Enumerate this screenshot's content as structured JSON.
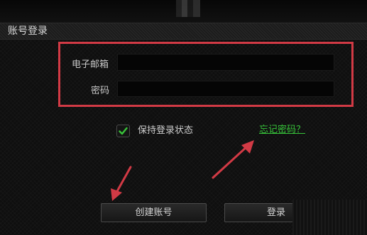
{
  "window": {
    "title": "账号登录"
  },
  "form": {
    "email_label": "电子邮箱",
    "password_label": "密码",
    "email_value": "",
    "password_value": ""
  },
  "remember": {
    "label": "保持登录状态",
    "checked": true
  },
  "forgot_link": "忘记密码？",
  "buttons": {
    "create_label": "创建账号",
    "login_label": "登录"
  },
  "colors": {
    "highlight_box": "#d23a45",
    "arrow": "#d23a45",
    "link": "#37c43a",
    "checkmark": "#39c43a"
  }
}
